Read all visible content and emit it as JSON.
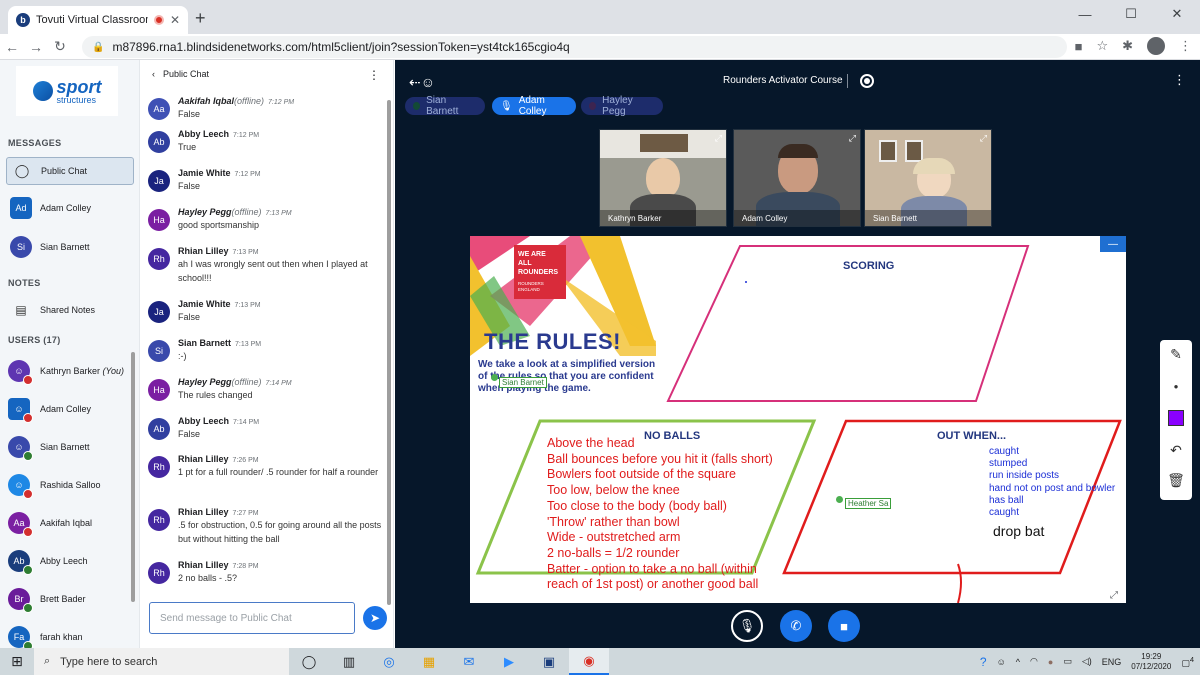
{
  "browser": {
    "tab_title": "Tovuti Virtual Classroom - Ro",
    "favicon": "b",
    "url": "m87896.rna1.blindsidenetworks.com/html5client/join?sessionToken=yst4tck165cgio4q"
  },
  "sidebar": {
    "logo_main": "sport",
    "logo_sub": "structures",
    "messages_header": "MESSAGES",
    "nav": [
      {
        "initials": "",
        "label": "Public Chat",
        "color": "#dce6f0"
      },
      {
        "initials": "Ad",
        "label": "Adam Colley",
        "color": "#1565c0"
      },
      {
        "initials": "Si",
        "label": "Sian Barnett",
        "color": "#3949ab"
      }
    ],
    "notes_header": "NOTES",
    "shared_notes": "Shared Notes",
    "users_header": "USERS (17)",
    "users": [
      {
        "initials": "",
        "name": "Kathryn Barker",
        "suffix": "(You)",
        "color": "#5e35b1",
        "status": "red"
      },
      {
        "initials": "",
        "name": "Adam Colley",
        "suffix": "",
        "color": "#1565c0",
        "status": "red"
      },
      {
        "initials": "",
        "name": "Sian Barnett",
        "suffix": "",
        "color": "#3949ab",
        "status": "green"
      },
      {
        "initials": "",
        "name": "Rashida Salloo",
        "suffix": "",
        "color": "#1e88e5",
        "status": "red"
      },
      {
        "initials": "Aa",
        "name": "Aakifah Iqbal",
        "suffix": "",
        "color": "#7b1fa2",
        "status": "red"
      },
      {
        "initials": "Ab",
        "name": "Abby Leech",
        "suffix": "",
        "color": "#1a3d7c",
        "status": "green"
      },
      {
        "initials": "Br",
        "name": "Brett Bader",
        "suffix": "",
        "color": "#6a1b9a",
        "status": "green"
      },
      {
        "initials": "Fa",
        "name": "farah khan",
        "suffix": "",
        "color": "#1565c0",
        "status": "green"
      }
    ]
  },
  "chat": {
    "header": "Public Chat",
    "messages": [
      {
        "initials": "Aa",
        "name": "Aakifah Iqbal",
        "offline": "(offline)",
        "time": "7:12 PM",
        "text": "False",
        "color": "#3f51b5"
      },
      {
        "initials": "Ab",
        "name": "Abby Leech",
        "offline": "",
        "time": "7:12 PM",
        "text": "True",
        "color": "#303f9f"
      },
      {
        "initials": "Ja",
        "name": "Jamie White",
        "offline": "",
        "time": "7:12 PM",
        "text": "False",
        "color": "#1a237e"
      },
      {
        "initials": "Ha",
        "name": "Hayley Pegg",
        "offline": "(offline)",
        "time": "7:13 PM",
        "text": "good sportsmanship",
        "color": "#7b1fa2"
      },
      {
        "initials": "Rh",
        "name": "Rhian Lilley",
        "offline": "",
        "time": "7:13 PM",
        "text": "ah I was wrongly sent out then when I played at school!!!",
        "color": "#4527a0"
      },
      {
        "initials": "Ja",
        "name": "Jamie White",
        "offline": "",
        "time": "7:13 PM",
        "text": "False",
        "color": "#1a237e"
      },
      {
        "initials": "Si",
        "name": "Sian Barnett",
        "offline": "",
        "time": "7:13 PM",
        "text": ":-)",
        "color": "#3949ab"
      },
      {
        "initials": "Ha",
        "name": "Hayley Pegg",
        "offline": "(offline)",
        "time": "7:14 PM",
        "text": "The rules changed",
        "color": "#7b1fa2"
      },
      {
        "initials": "Ab",
        "name": "Abby Leech",
        "offline": "",
        "time": "7:14 PM",
        "text": "False",
        "color": "#303f9f"
      },
      {
        "initials": "Rh",
        "name": "Rhian Lilley",
        "offline": "",
        "time": "7:26 PM",
        "text": "1 pt for a full rounder/ .5 rounder for half a rounder",
        "color": "#4527a0"
      },
      {
        "initials": "Rh",
        "name": "Rhian Lilley",
        "offline": "",
        "time": "7:27 PM",
        "text": ".5 for obstruction, 0.5 for going around all the posts but without hitting the ball",
        "color": "#4527a0"
      },
      {
        "initials": "Rh",
        "name": "Rhian Lilley",
        "offline": "",
        "time": "7:28 PM",
        "text": "2 no balls - .5?",
        "color": "#4527a0"
      }
    ],
    "input_placeholder": "Send message to Public Chat"
  },
  "meeting": {
    "title": "Rounders Activator Course",
    "talkers": [
      {
        "name": "Sian Barnett",
        "talking": false
      },
      {
        "name": "Adam Colley",
        "talking": true
      },
      {
        "name": "Hayley Pegg",
        "talking": false
      }
    ],
    "videos": [
      {
        "name": "Kathryn Barker"
      },
      {
        "name": "Adam Colley"
      },
      {
        "name": "Sian Barnett"
      }
    ]
  },
  "slide": {
    "badge_line1": "WE ARE",
    "badge_line2": "ALL",
    "badge_line3": "ROUNDERS",
    "badge_small": "ROUNDERS ENGLAND",
    "title": "THE RULES!",
    "description": "We take a look at a simplified version of the rules so that you are confident when playing the game.",
    "cursor_sian": "Sian Barnet",
    "cursor_heather": "Heather Sa",
    "scoring_label": "SCORING",
    "noballs_label": "NO BALLS",
    "outwhen_label": "OUT WHEN...",
    "noballs_notes": [
      "Above the head",
      "Ball bounces before you hit it (falls short)",
      "Bowlers foot outside of the square",
      "Too low, below the knee",
      "Too close to the body (body ball)",
      "'Throw' rather than bowl",
      "Wide - outstretched arm",
      "2 no-balls  = 1/2 rounder",
      "Batter - option to take a no ball (within",
      "reach of 1st post) or another good ball"
    ],
    "out_notes": [
      "caught",
      "stumped",
      "run inside posts",
      "hand not on post and bowler",
      "has ball",
      "caught"
    ],
    "drop_bat": "drop bat"
  },
  "taskbar": {
    "search_placeholder": "Type here to search",
    "lang": "ENG",
    "time": "19:29",
    "date": "07/12/2020",
    "notif_count": "4"
  }
}
